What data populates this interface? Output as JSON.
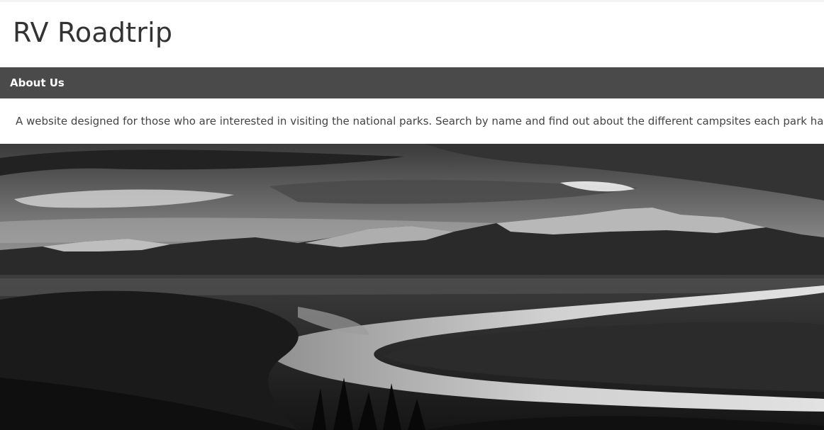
{
  "header": {
    "title": "RV Roadtrip"
  },
  "nav": {
    "items": [
      {
        "label": "About Us"
      }
    ]
  },
  "about": {
    "text": "A website designed for those who are interested in visiting the national parks. Search by name and find out about the different campsites each park has."
  },
  "hero": {
    "icon": "landscape-photo",
    "style": "black-and-white mountain river landscape",
    "colors": {
      "sky_light": "#cfcfcf",
      "sky_dark": "#2c2c2c",
      "mountains": "#2a2a2a",
      "snow": "#d8d8d8",
      "river": "#bdbdbd",
      "forest": "#1a1a1a"
    }
  },
  "theme": {
    "nav_bg": "#4a4a4a",
    "nav_text": "#ffffff",
    "title_color": "#333333",
    "body_text": "#444444"
  }
}
